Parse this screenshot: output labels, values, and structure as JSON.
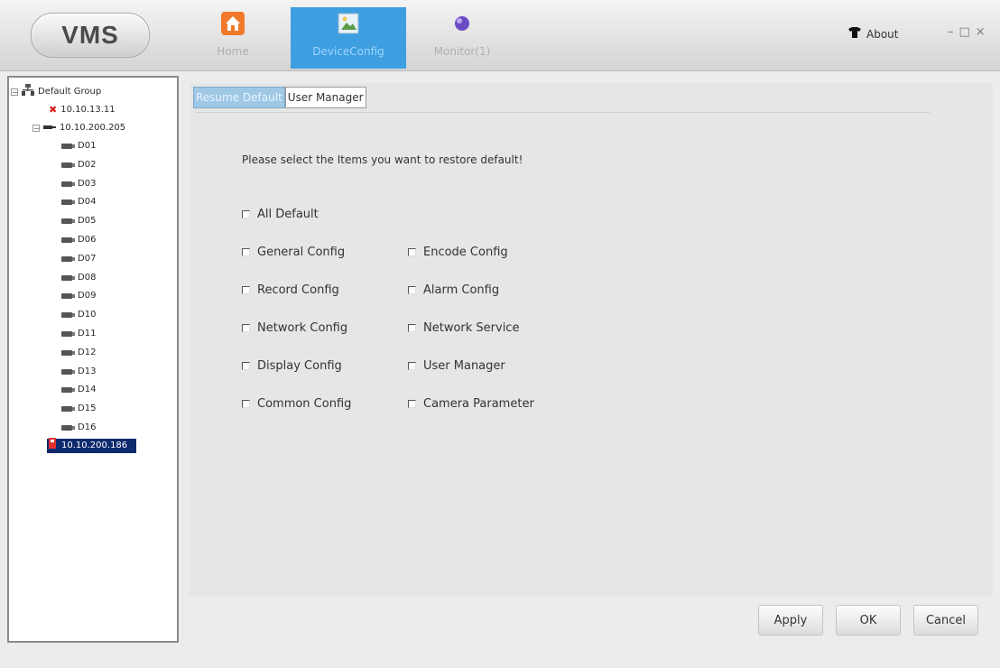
{
  "app": {
    "logo": "VMS"
  },
  "nav": {
    "tabs": [
      {
        "label": "Home",
        "icon": "home-icon"
      },
      {
        "label": "DeviceConfig",
        "icon": "device-config-icon"
      },
      {
        "label": "Monitor(1)",
        "icon": "monitor-icon"
      }
    ],
    "active": "DeviceConfig",
    "about": "About"
  },
  "window_controls": {
    "minimize": "–",
    "maximize": "□",
    "close": "×"
  },
  "tree": {
    "root": "Default Group",
    "devices": [
      {
        "label": "10.10.13.11",
        "status": "offline"
      },
      {
        "label": "10.10.200.205",
        "status": "online",
        "channels": [
          "D01",
          "D02",
          "D03",
          "D04",
          "D05",
          "D06",
          "D07",
          "D08",
          "D09",
          "D10",
          "D11",
          "D12",
          "D13",
          "D14",
          "D15",
          "D16"
        ]
      },
      {
        "label": "10.10.200.186",
        "status": "selected"
      }
    ]
  },
  "main": {
    "tabs": [
      "Resume Default",
      "User Manager"
    ],
    "prompt": "Please select the Items you want to restore default!",
    "options": {
      "all": "All Default",
      "left": [
        "General Config",
        "Record Config",
        "Network Config",
        "Display Config",
        "Common Config"
      ],
      "right": [
        "Encode Config",
        "Alarm Config",
        "Network Service",
        "User Manager",
        "Camera Parameter"
      ]
    }
  },
  "buttons": {
    "apply": "Apply",
    "ok": "OK",
    "cancel": "Cancel"
  },
  "colors": {
    "accent": "#3d9fe0",
    "selected": "#0d2a6e",
    "offline": "#d82020"
  }
}
